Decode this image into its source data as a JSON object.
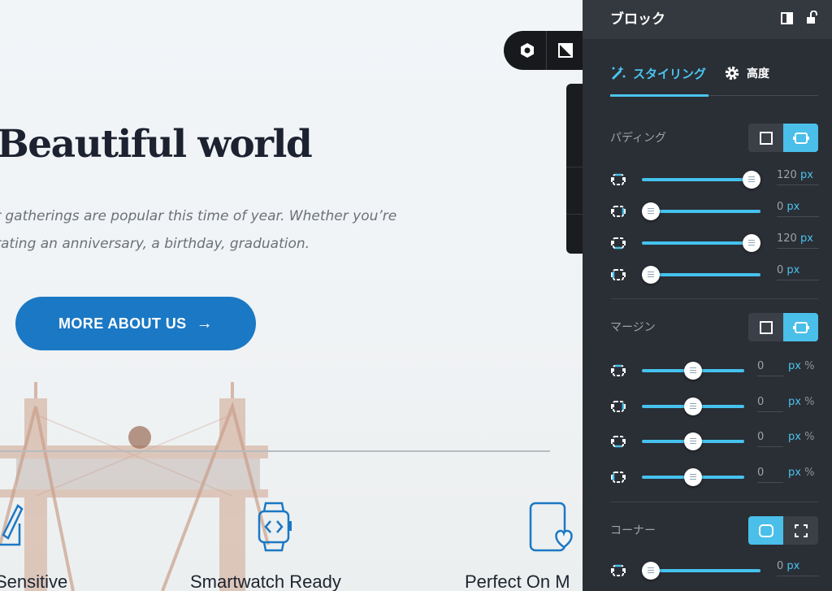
{
  "canvas": {
    "hero": {
      "title": "Beautiful world",
      "line1": "r gatherings are popular this time of year. Whether you’re",
      "line2": "rating an anniversary, a birthday, graduation."
    },
    "cta": {
      "label": "MORE ABOUT US",
      "arrow": "→"
    },
    "features": [
      {
        "label": "Sensitive",
        "icon": "edit-square-icon"
      },
      {
        "label": "Smartwatch Ready",
        "icon": "smartwatch-code-icon"
      },
      {
        "label": "Perfect On M",
        "icon": "tablet-heart-icon"
      }
    ],
    "accent_color": "#1b78c4"
  },
  "panel": {
    "title": "ブロック",
    "tabs": [
      {
        "label": "スタイリング",
        "icon": "magic-wand-icon",
        "active": true
      },
      {
        "label": "高度",
        "icon": "gear-icon",
        "active": false
      }
    ],
    "padding": {
      "label": "パディング",
      "rows": [
        {
          "value": "120",
          "unit": "px",
          "fraction": 1.0
        },
        {
          "value": "0",
          "unit": "px",
          "fraction": 0.0
        },
        {
          "value": "120",
          "unit": "px",
          "fraction": 1.0
        },
        {
          "value": "0",
          "unit": "px",
          "fraction": 0.0
        }
      ]
    },
    "margin": {
      "label": "マージン",
      "rows": [
        {
          "value": "0",
          "unit": "px",
          "alt_unit": "%",
          "fraction": 0.5
        },
        {
          "value": "0",
          "unit": "px",
          "alt_unit": "%",
          "fraction": 0.5
        },
        {
          "value": "0",
          "unit": "px",
          "alt_unit": "%",
          "fraction": 0.5
        },
        {
          "value": "0",
          "unit": "px",
          "alt_unit": "%",
          "fraction": 0.5
        }
      ]
    },
    "corner": {
      "label": "コーナー",
      "rows": [
        {
          "value": "0",
          "unit": "px",
          "fraction": 0.0
        }
      ]
    },
    "accent_color": "#49bfe9"
  }
}
